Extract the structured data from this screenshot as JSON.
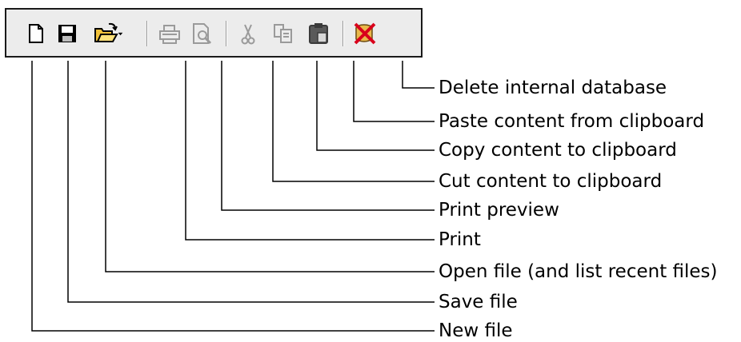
{
  "toolbar": {
    "buttons": [
      {
        "icon": "new-file-icon",
        "label": "New file",
        "enabled": true
      },
      {
        "icon": "save-icon",
        "label": "Save file",
        "enabled": true
      },
      {
        "icon": "open-folder-icon",
        "label": "Open file (and list recent files)",
        "enabled": true
      },
      {
        "icon": "printer-icon",
        "label": "Print",
        "enabled": false
      },
      {
        "icon": "print-preview-icon",
        "label": "Print preview",
        "enabled": false
      },
      {
        "icon": "scissors-icon",
        "label": "Cut content to clipboard",
        "enabled": false
      },
      {
        "icon": "copy-icon",
        "label": "Copy content to clipboard",
        "enabled": false
      },
      {
        "icon": "clipboard-icon",
        "label": "Paste content from clipboard",
        "enabled": true
      },
      {
        "icon": "delete-database-icon",
        "label": "Delete internal database",
        "enabled": true
      }
    ]
  },
  "colors": {
    "accent_red": "#d9001b",
    "disabled_gray": "#9a9a9a",
    "enabled_black": "#000000"
  }
}
